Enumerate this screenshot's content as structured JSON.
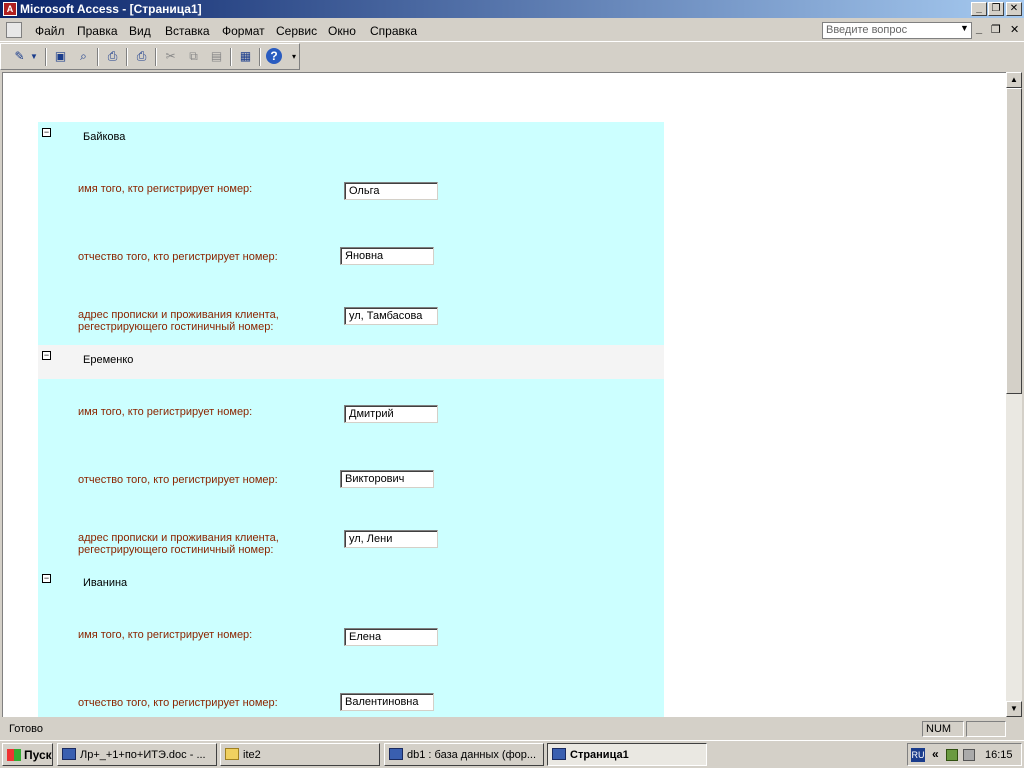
{
  "window": {
    "title": "Microsoft Access - [Страница1]"
  },
  "menu": {
    "items": [
      "Файл",
      "Правка",
      "Вид",
      "Вставка",
      "Формат",
      "Сервис",
      "Окно",
      "Справка"
    ],
    "ask_placeholder": "Введите вопрос"
  },
  "groups": [
    {
      "name": "Байкова",
      "fields": [
        {
          "label": "имя того, кто регистрирует номер:",
          "value": "Ольга"
        },
        {
          "label": "отчество того, кто регистрирует номер:",
          "value": "Яновна"
        },
        {
          "label_line1": "адрес прописки и проживания клиента,",
          "label_line2": "регестрирующего гостиничный номер:",
          "value": "ул, Тамбасова"
        }
      ]
    },
    {
      "name": "Еременко",
      "fields": [
        {
          "label": "имя того, кто регистрирует номер:",
          "value": "Дмитрий"
        },
        {
          "label": "отчество того, кто регистрирует номер:",
          "value": "Викторович"
        },
        {
          "label_line1": "адрес прописки и проживания клиента,",
          "label_line2": "регестрирующего гостиничный номер:",
          "value": "ул, Лени"
        }
      ]
    },
    {
      "name": "Иванина",
      "fields": [
        {
          "label": "имя того, кто регистрирует номер:",
          "value": "Елена"
        },
        {
          "label": "отчество того, кто регистрирует номер:",
          "value": "Валентиновна"
        }
      ]
    }
  ],
  "status": {
    "text": "Готово",
    "num": "NUM"
  },
  "taskbar": {
    "start": "Пуск",
    "tasks": [
      {
        "label": "Лр+_+1+по+ИТЭ.doc - ..."
      },
      {
        "label": "ite2"
      },
      {
        "label": "db1 : база данных (фор..."
      },
      {
        "label": "Страница1"
      }
    ],
    "lang": "RU",
    "clock": "16:15"
  }
}
